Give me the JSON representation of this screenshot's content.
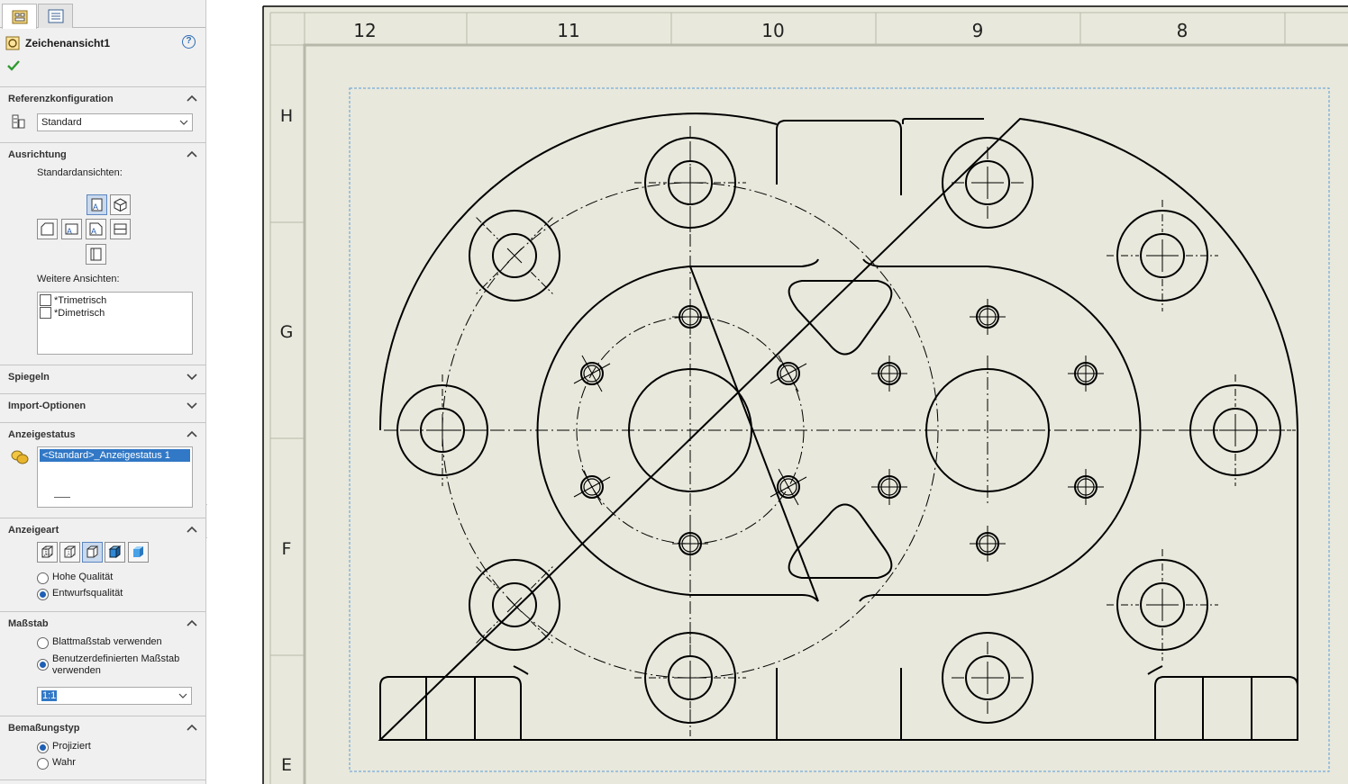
{
  "panel": {
    "tabs": [
      {
        "name": "property-manager",
        "icon": "property-manager-icon"
      },
      {
        "name": "feature-tree",
        "icon": "feature-tree-icon"
      }
    ],
    "title": "Zeichenansicht1",
    "help_icon": "?",
    "sections": {
      "reference": {
        "header": "Referenzkonfiguration",
        "config_value": "Standard"
      },
      "orientation": {
        "header": "Ausrichtung",
        "standard_views_label": "Standardansichten:",
        "more_views_label": "Weitere Ansichten:",
        "more_views": [
          "*Trimetrisch",
          "*Dimetrisch"
        ]
      },
      "mirror": {
        "header": "Spiegeln"
      },
      "import": {
        "header": "Import-Optionen"
      },
      "display_state": {
        "header": "Anzeigestatus",
        "selected": "<Standard>_Anzeigestatus 1"
      },
      "display_style": {
        "header": "Anzeigeart",
        "options": [
          "Hohe Qualität",
          "Entwurfsqualität"
        ],
        "selected_index": 1
      },
      "scale": {
        "header": "Maßstab",
        "options": [
          "Blattmaßstab verwenden",
          "Benutzerdefinierten Maßstab verwenden"
        ],
        "selected_index": 1,
        "custom_value": "1:1"
      },
      "dimension_type": {
        "header": "Bemaßungstyp",
        "options": [
          "Projiziert",
          "Wahr"
        ],
        "selected_index": 0
      }
    }
  },
  "sheet": {
    "zone_columns": [
      "12",
      "11",
      "10",
      "9",
      "8"
    ],
    "zone_rows": [
      "H",
      "G",
      "F",
      "E"
    ],
    "paper_color": "#e8e8dc",
    "line_color": "#000000",
    "selection_box_color": "#5a9bd8"
  }
}
